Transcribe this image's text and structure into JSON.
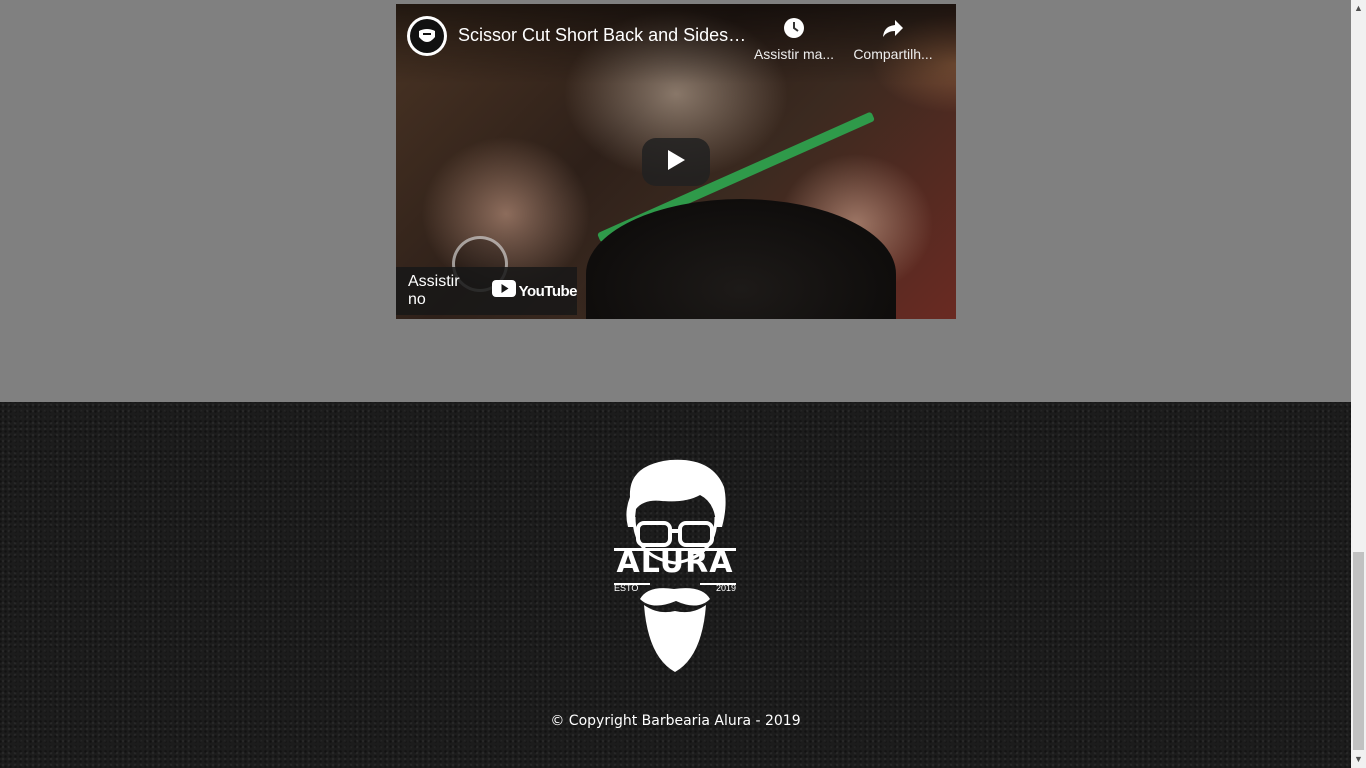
{
  "video": {
    "title": "Scissor Cut Short Back and Sides ...",
    "watch_later_label": "Assistir ma...",
    "share_label": "Compartilh...",
    "watch_on_label": "Assistir no",
    "youtube_logo_text": "YouTube",
    "icons": {
      "watch_later": "clock-icon",
      "share": "share-arrow-icon",
      "play": "play-icon",
      "youtube": "youtube-logo-icon"
    }
  },
  "footer": {
    "logo": {
      "brand": "ALURA",
      "esto": "ESTO",
      "year": "2019"
    },
    "copyright": "© Copyright Barbearia Alura - 2019"
  },
  "colors": {
    "page_bg": "#808080",
    "footer_bg": "#1c1c1c",
    "youtube_red": "#ff0000"
  }
}
